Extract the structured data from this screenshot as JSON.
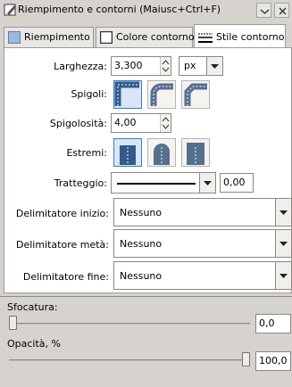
{
  "window": {
    "title": "Riempimento e contorni (Maiusc+Ctrl+F)"
  },
  "tabs": [
    {
      "label": "Riempimento"
    },
    {
      "label": "Colore contorno"
    },
    {
      "label": "Stile contorno",
      "active": true
    }
  ],
  "stroke_style": {
    "width_label": "Larghezza:",
    "width_value": "3,300",
    "unit_value": "px",
    "join_label": "Spigoli:",
    "join_buttons": [
      "miter-join-icon",
      "round-join-icon",
      "bevel-join-icon"
    ],
    "miter_label": "Spigolosità:",
    "miter_value": "4,00",
    "cap_label": "Estremi:",
    "cap_buttons": [
      "butt-cap-icon",
      "round-cap-icon",
      "square-cap-icon"
    ],
    "dash_label": "Tratteggio:",
    "dash_offset": "0,00",
    "start_marker_label": "Delimitatore inizio:",
    "start_marker_value": "Nessuno",
    "mid_marker_label": "Delimitatore metà:",
    "mid_marker_value": "Nessuno",
    "end_marker_label": "Delimitatore fine:",
    "end_marker_value": "Nessuno"
  },
  "blur": {
    "label": "Sfocatura:",
    "value": "0,0",
    "level": 0
  },
  "opacity": {
    "label": "Opacità, %",
    "value": "100,0",
    "level": 100
  },
  "colors": {
    "accent": "#3c7ebd",
    "window_bg": "#d6d3ce"
  }
}
